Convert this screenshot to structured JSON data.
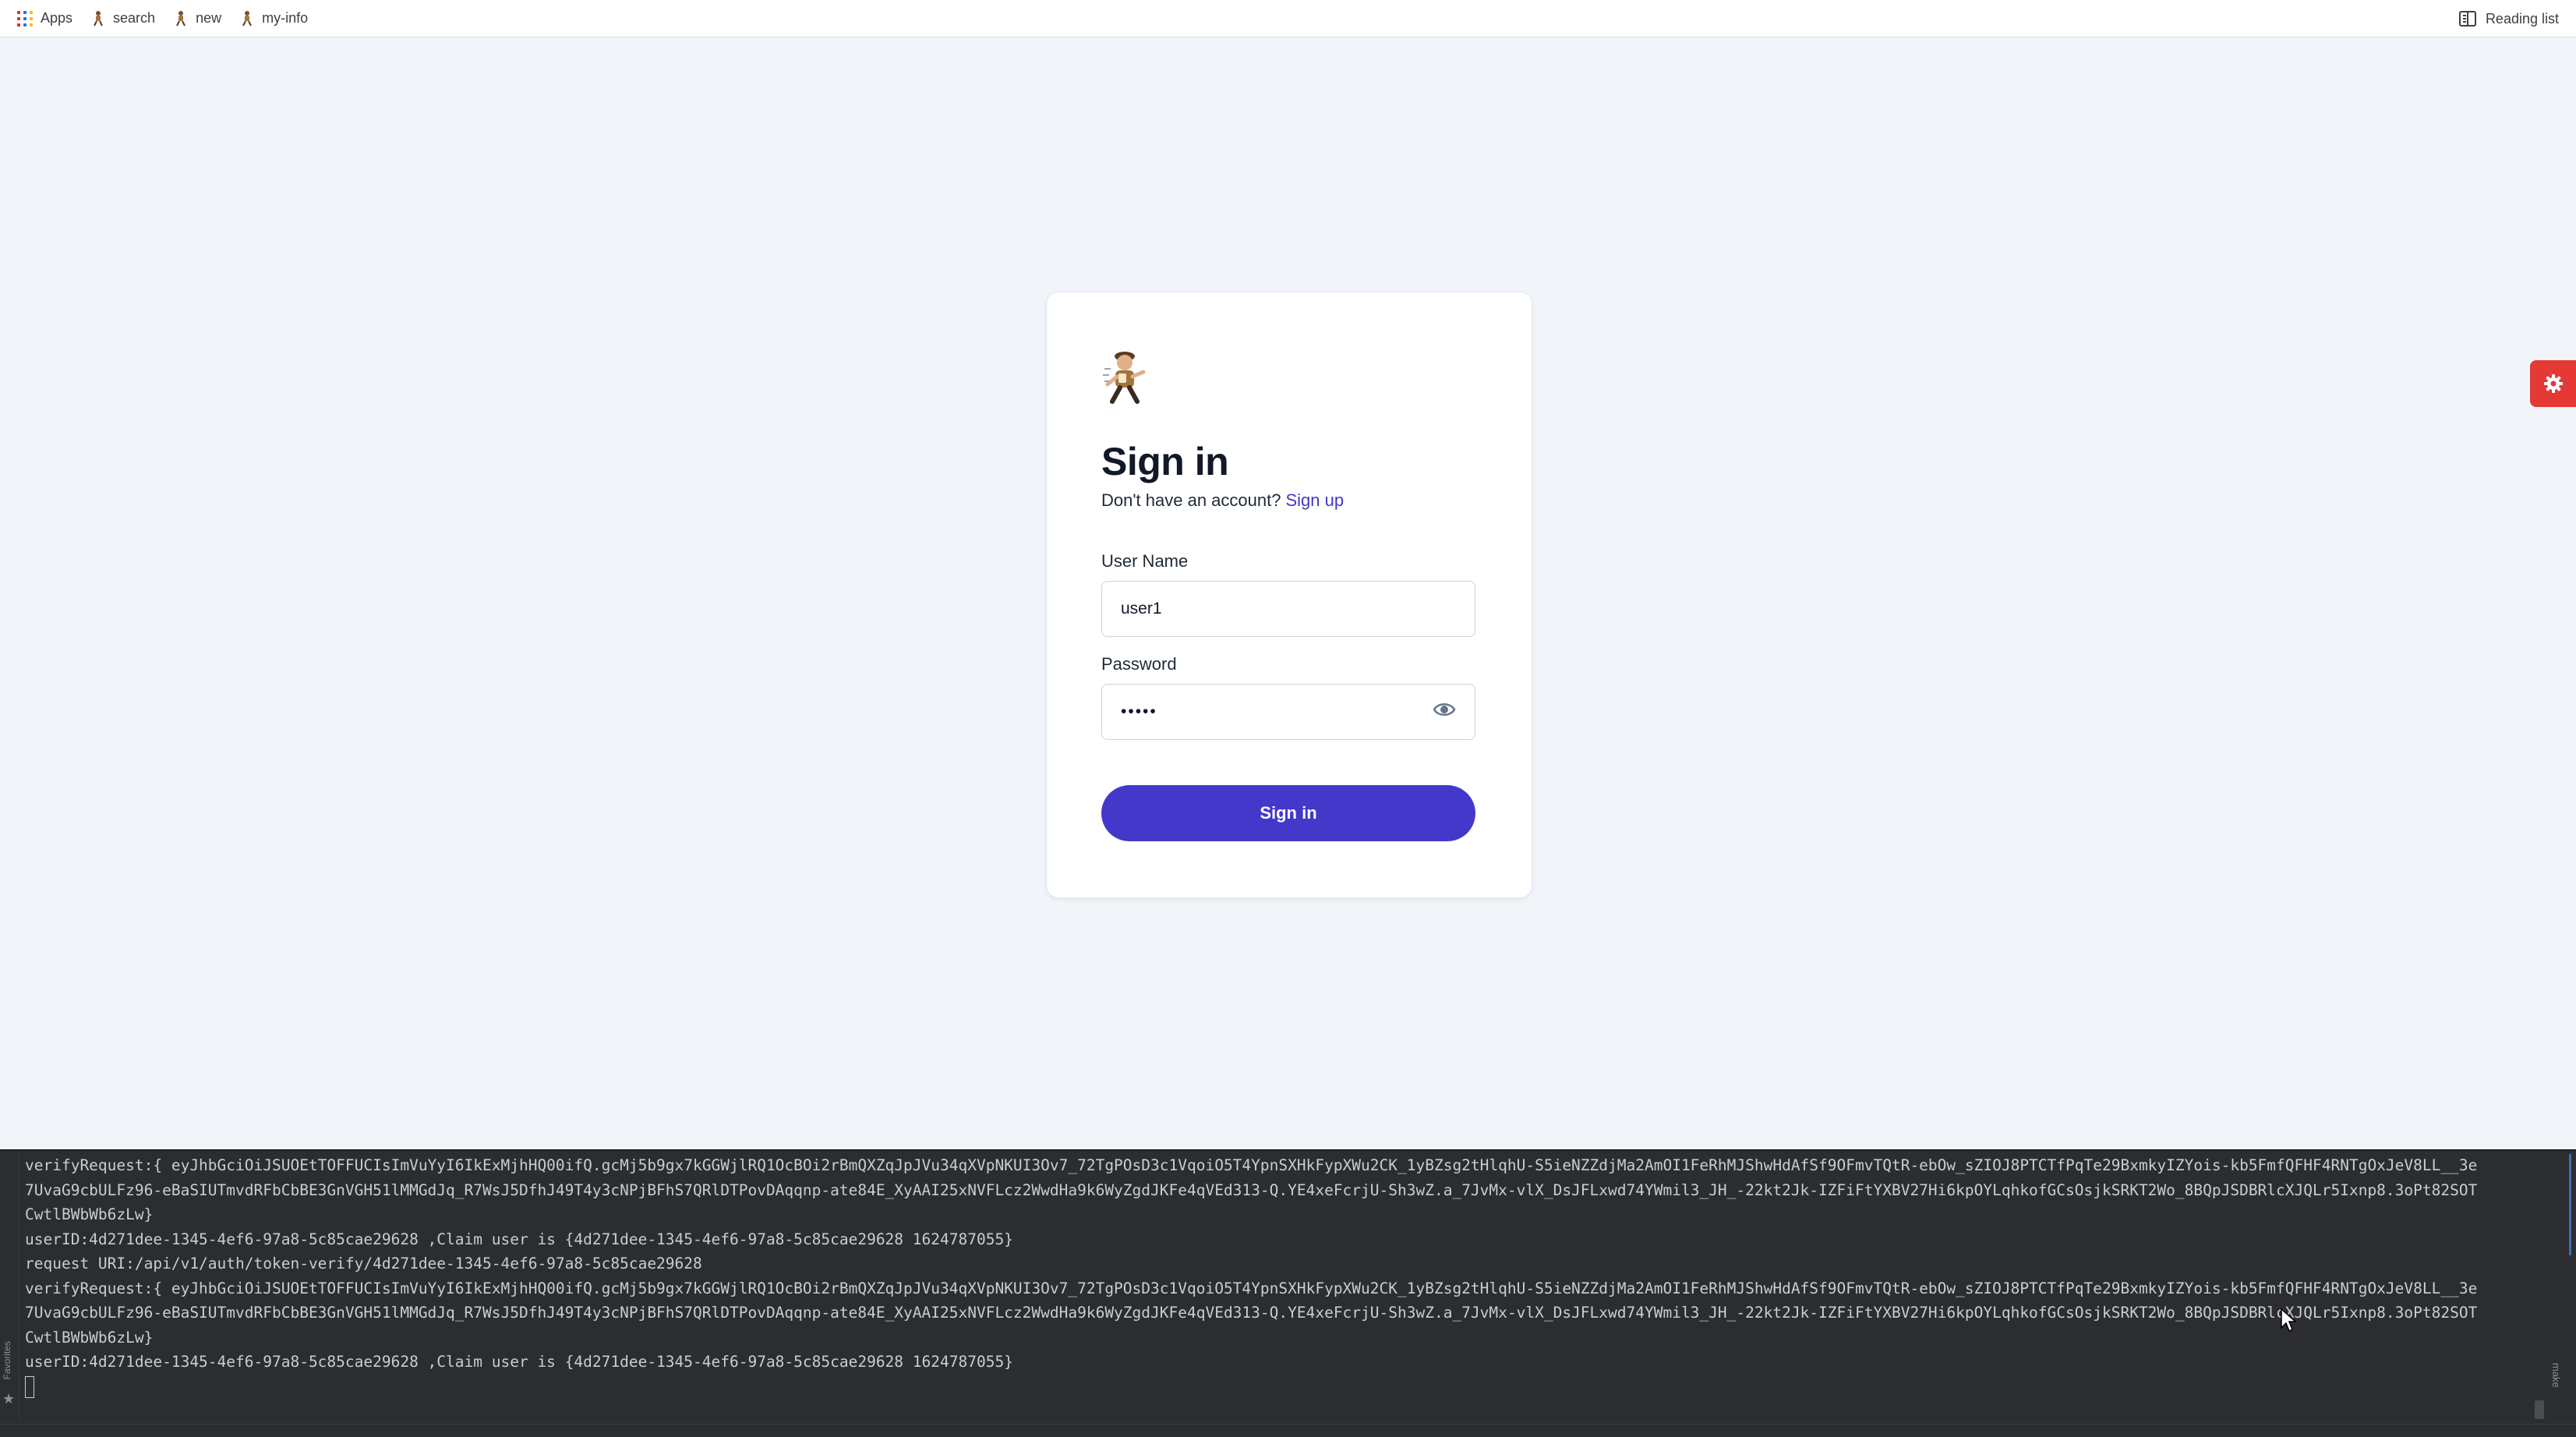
{
  "bookmarks": {
    "items": [
      {
        "label": "Apps",
        "icon": "apps-grid-icon"
      },
      {
        "label": "search",
        "icon": "runner-icon"
      },
      {
        "label": "new",
        "icon": "runner-icon"
      },
      {
        "label": "my-info",
        "icon": "runner-icon"
      }
    ],
    "reading_list": "Reading list"
  },
  "signin": {
    "title": "Sign in",
    "no_account_text": "Don't have an account?",
    "signup_link": "Sign up",
    "username_label": "User Name",
    "username_value": "user1",
    "password_label": "Password",
    "password_value": "•••••",
    "submit_label": "Sign in"
  },
  "terminal": {
    "lines": [
      "verifyRequest:{ eyJhbGciOiJSUOEtTOFFUCIsImVuYyI6IkExMjhHQ00ifQ.gcMj5b9gx7kGGWjlRQ1OcBOi2rBmQXZqJpJVu34qXVpNKUI3Ov7_72TgPOsD3c1VqoiO5T4YpnSXHkFypXWu2CK_1yBZsg2tHlqhU-S5ieNZZdjMa2AmOI1FeRhMJShwHdAfSf9OFmvTQtR-ebOw_sZIOJ8PTCTfPqTe29BxmkyIZYois-kb5FmfQFHF4RNTgOxJeV8LL__3e",
      "7UvaG9cbULFz96-eBaSIUTmvdRFbCbBE3GnVGH51lMMGdJq_R7WsJ5DfhJ49T4y3cNPjBFhS7QRlDTPovDAqqnp-ate84E_XyAAI25xNVFLcz2WwdHa9k6WyZgdJKFe4qVEd313-Q.YE4xeFcrjU-Sh3wZ.a_7JvMx-vlX_DsJFLxwd74YWmil3_JH_-22kt2Jk-IZFiFtYXBV27Hi6kpOYLqhkofGCsOsjkSRKT2Wo_8BQpJSDBRlcXJQLr5Ixnp8.3oPt82SOT",
      "CwtlBWbWb6zLw}",
      "userID:4d271dee-1345-4ef6-97a8-5c85cae29628 ,Claim user is {4d271dee-1345-4ef6-97a8-5c85cae29628 1624787055}",
      "request URI:/api/v1/auth/token-verify/4d271dee-1345-4ef6-97a8-5c85cae29628",
      "verifyRequest:{ eyJhbGciOiJSUOEtTOFFUCIsImVuYyI6IkExMjhHQ00ifQ.gcMj5b9gx7kGGWjlRQ1OcBOi2rBmQXZqJpJVu34qXVpNKUI3Ov7_72TgPOsD3c1VqoiO5T4YpnSXHkFypXWu2CK_1yBZsg2tHlqhU-S5ieNZZdjMa2AmOI1FeRhMJShwHdAfSf9OFmvTQtR-ebOw_sZIOJ8PTCTfPqTe29BxmkyIZYois-kb5FmfQFHF4RNTgOxJeV8LL__3e",
      "7UvaG9cbULFz96-eBaSIUTmvdRFbCbBE3GnVGH51lMMGdJq_R7WsJ5DfhJ49T4y3cNPjBFhS7QRlDTPovDAqqnp-ate84E_XyAAI25xNVFLcz2WwdHa9k6WyZgdJKFe4qVEd313-Q.YE4xeFcrjU-Sh3wZ.a_7JvMx-vlX_DsJFLxwd74YWmil3_JH_-22kt2Jk-IZFiFtYXBV27Hi6kpOYLqhkofGCsOsjkSRKT2Wo_8BQpJSDBRlcXJQLr5Ixnp8.3oPt82SOT",
      "CwtlBWbWb6zLw}",
      "userID:4d271dee-1345-4ef6-97a8-5c85cae29628 ,Claim user is {4d271dee-1345-4ef6-97a8-5c85cae29628 1624787055}"
    ],
    "favorites_label": "Favorites",
    "make_label": "make"
  },
  "colors": {
    "accent": "#4338ca",
    "settings_tab": "#e53935",
    "page_bg": "#f1f5f9",
    "terminal_bg": "#2b2d30"
  }
}
